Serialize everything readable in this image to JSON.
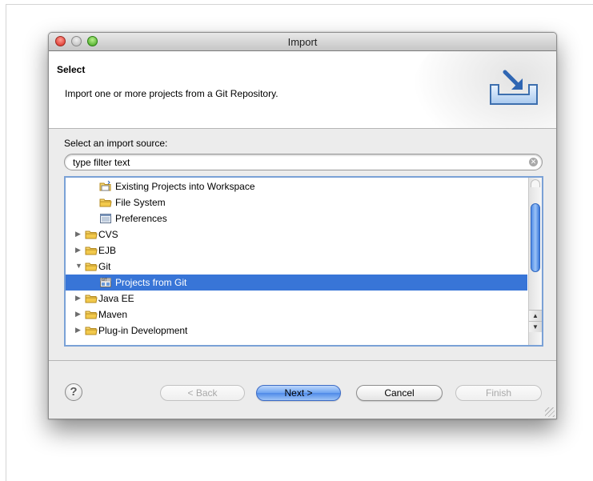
{
  "window": {
    "title": "Import"
  },
  "banner": {
    "title": "Select",
    "description": "Import one or more projects from a Git Repository.",
    "icon": "import-wizard-icon"
  },
  "source": {
    "label": "Select an import source:",
    "filter_value": "type filter text",
    "filter_placeholder": "type filter text"
  },
  "tree": {
    "items": [
      {
        "label": "Existing Projects into Workspace",
        "icon": "project-icon",
        "level": 1
      },
      {
        "label": "File System",
        "icon": "folder-icon",
        "level": 1
      },
      {
        "label": "Preferences",
        "icon": "preferences-icon",
        "level": 1
      },
      {
        "label": "CVS",
        "icon": "folder-icon",
        "level": 0,
        "expandable": true,
        "expanded": false
      },
      {
        "label": "EJB",
        "icon": "folder-icon",
        "level": 0,
        "expandable": true,
        "expanded": false
      },
      {
        "label": "Git",
        "icon": "folder-icon",
        "level": 0,
        "expandable": true,
        "expanded": true
      },
      {
        "label": "Projects from Git",
        "icon": "git-icon",
        "level": 1,
        "selected": true
      },
      {
        "label": "Java EE",
        "icon": "folder-icon",
        "level": 0,
        "expandable": true,
        "expanded": false
      },
      {
        "label": "Maven",
        "icon": "folder-icon",
        "level": 0,
        "expandable": true,
        "expanded": false
      },
      {
        "label": "Plug-in Development",
        "icon": "folder-icon",
        "level": 0,
        "expandable": true,
        "expanded": false
      }
    ],
    "scroll_position": 0.25
  },
  "buttons": {
    "back": "< Back",
    "next": "Next >",
    "cancel": "Cancel",
    "finish": "Finish"
  },
  "colors": {
    "selection": "#3875d7",
    "focus_ring": "#7aa1d6",
    "default_button": "#6ea3f1",
    "folder": "#f2c94c"
  }
}
